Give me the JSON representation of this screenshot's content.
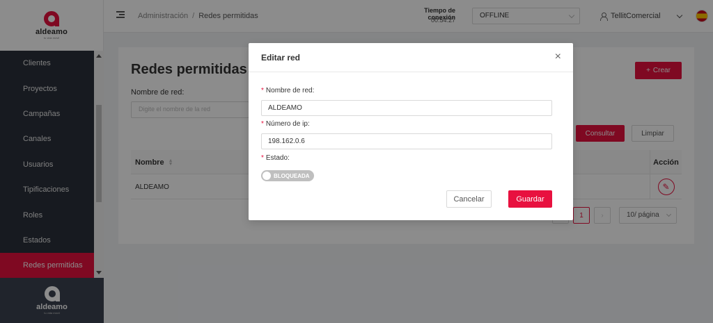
{
  "brand": {
    "name": "aldeamo",
    "tagline": "tu vida móvil",
    "accent": "#e8113f"
  },
  "sidebar": {
    "items": [
      {
        "label": "Clientes"
      },
      {
        "label": "Proyectos"
      },
      {
        "label": "Campañas"
      },
      {
        "label": "Canales"
      },
      {
        "label": "Usuarios"
      },
      {
        "label": "Tipificaciones"
      },
      {
        "label": "Roles"
      },
      {
        "label": "Estados"
      },
      {
        "label": "Redes permitidas",
        "active": true
      }
    ]
  },
  "header": {
    "breadcrumb": [
      "Administración",
      "Redes permitidas"
    ],
    "connection_label": "Tiempo de conexión",
    "connection_time": "00:54:27",
    "status": "OFFLINE",
    "user": "TellitComercial",
    "flag_icon": "spain-flag-icon"
  },
  "page": {
    "title": "Redes permitidas",
    "create_label": "Crear",
    "filter_label": "Nombre de red:",
    "filter_placeholder": "Digite el nombre de la red",
    "consult_label": "Consultar",
    "clear_label": "Limpiar",
    "table": {
      "columns": [
        "Nombre",
        "Acción"
      ],
      "rows": [
        {
          "name": "ALDEAMO"
        }
      ]
    },
    "pagination": {
      "current_page": "1",
      "page_size": "10/ página"
    }
  },
  "modal": {
    "title": "Editar red",
    "name_label": "Nombre de red:",
    "name_value": "ALDEAMO",
    "ip_label": "Número de ip:",
    "ip_value": "198.162.0.6",
    "state_label": "Estado:",
    "state_value": "BLOQUEADA",
    "cancel_label": "Cancelar",
    "save_label": "Guardar"
  }
}
